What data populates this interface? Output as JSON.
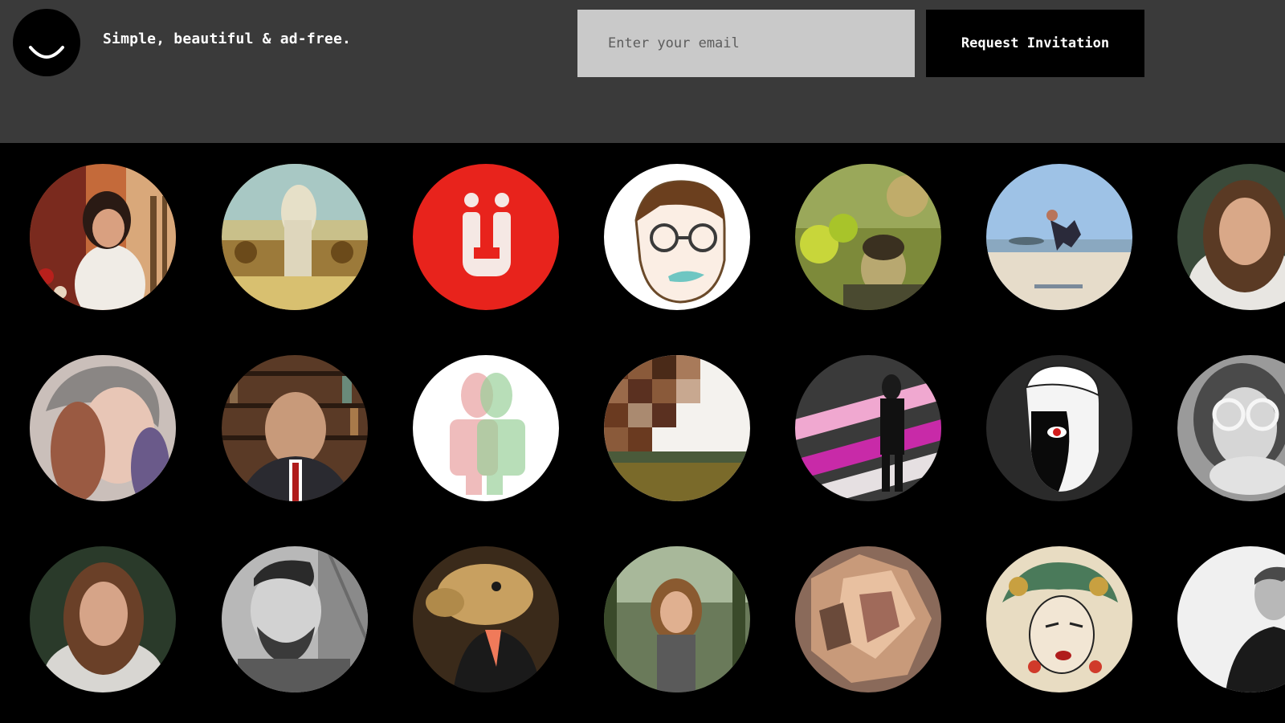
{
  "header": {
    "tagline": "Simple, beautiful & ad-free.",
    "email_placeholder": "Enter your email",
    "email_value": "",
    "request_button_label": "Request Invitation",
    "logo_icon": "smile-icon",
    "background_color": "#3a3a3a"
  },
  "avatar_grid": {
    "background_color": "#000000",
    "rows": [
      [
        "woman-portrait-warm",
        "blurred-figure-sepia",
        "u-umlaut-logo-red",
        "cartoon-man-glasses",
        "man-with-foliage",
        "jumping-on-beach",
        "woman-long-hair"
      ],
      [
        "woman-beanie",
        "man-suit-bookshelf",
        "bust-red-green-anaglyph",
        "pixelated-landscape",
        "woman-pink-stripes",
        "illustrated-face-black-white",
        "woman-glasses-bw"
      ],
      [
        "woman-long-hair-2",
        "man-beard-bw",
        "camel-mask-man",
        "woman-smiling-forest",
        "crumpled-paper-warm",
        "medusa-illustration",
        "man-profile-bw"
      ]
    ],
    "u_umlaut_text": "Ü"
  }
}
